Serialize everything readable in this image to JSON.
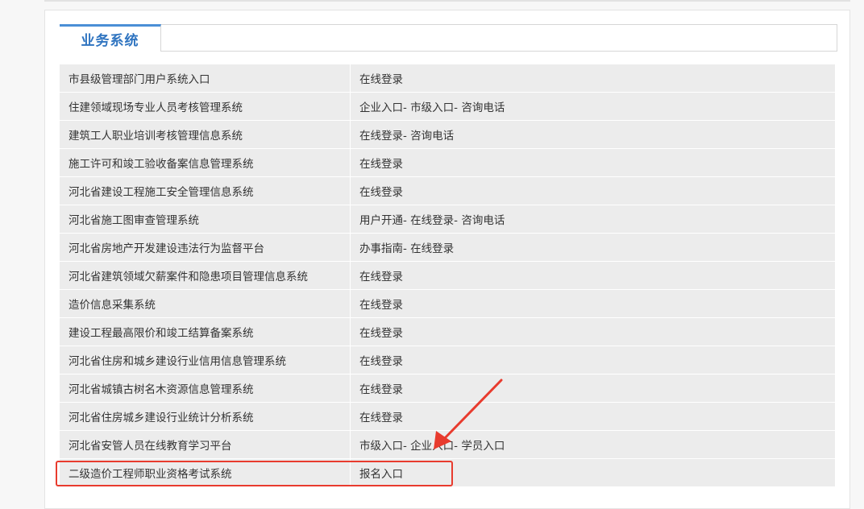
{
  "section": {
    "tab_title": "业务系统"
  },
  "rows": [
    {
      "name": "市县级管理部门用户系统入口",
      "links": [
        "在线登录"
      ]
    },
    {
      "name": "住建领域现场专业人员考核管理系统",
      "links": [
        "企业入口",
        "市级入口",
        "咨询电话"
      ]
    },
    {
      "name": "建筑工人职业培训考核管理信息系统",
      "links": [
        "在线登录",
        "咨询电话"
      ]
    },
    {
      "name": "施工许可和竣工验收备案信息管理系统",
      "links": [
        "在线登录"
      ]
    },
    {
      "name": "河北省建设工程施工安全管理信息系统",
      "links": [
        "在线登录"
      ]
    },
    {
      "name": "河北省施工图审查管理系统",
      "links": [
        "用户开通",
        "在线登录",
        "咨询电话"
      ]
    },
    {
      "name": "河北省房地产开发建设违法行为监督平台",
      "links": [
        "办事指南",
        "在线登录"
      ]
    },
    {
      "name": "河北省建筑领域欠薪案件和隐患项目管理信息系统",
      "links": [
        "在线登录"
      ]
    },
    {
      "name": "造价信息采集系统",
      "links": [
        "在线登录"
      ]
    },
    {
      "name": "建设工程最高限价和竣工结算备案系统",
      "links": [
        "在线登录"
      ]
    },
    {
      "name": "河北省住房和城乡建设行业信用信息管理系统",
      "links": [
        "在线登录"
      ]
    },
    {
      "name": "河北省城镇古树名木资源信息管理系统",
      "links": [
        "在线登录"
      ]
    },
    {
      "name": "河北省住房城乡建设行业统计分析系统",
      "links": [
        "在线登录"
      ]
    },
    {
      "name": "河北省安管人员在线教育学习平台",
      "links": [
        "市级入口",
        "企业入口",
        "学员入口"
      ]
    },
    {
      "name": "二级造价工程师职业资格考试系统",
      "links": [
        "报名入口"
      ]
    }
  ],
  "link_separator": "- ",
  "annotation": {
    "color": "#e83b2e",
    "highlighted_row": "二级造价工程师职业资格考试系统"
  }
}
